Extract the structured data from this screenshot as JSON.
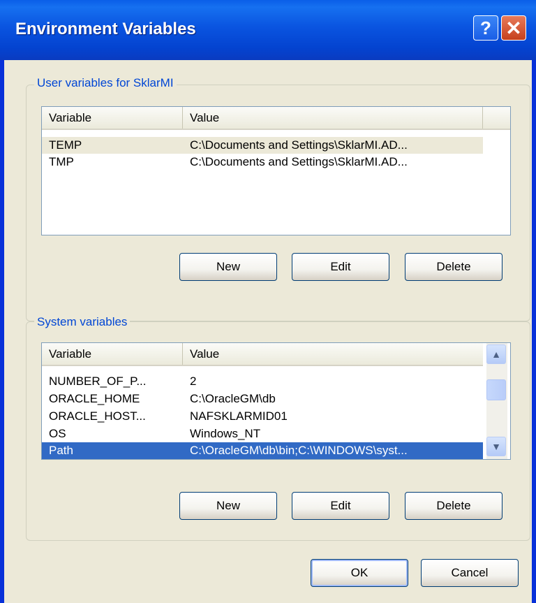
{
  "window": {
    "title": "Environment Variables",
    "help_icon": "help-icon",
    "close_icon": "close-icon"
  },
  "user_group": {
    "title": "User variables for SklarMI",
    "columns": [
      "Variable",
      "Value"
    ],
    "rows": [
      {
        "variable": "TEMP",
        "value": "C:\\Documents and Settings\\SklarMI.AD..."
      },
      {
        "variable": "TMP",
        "value": "C:\\Documents and Settings\\SklarMI.AD..."
      }
    ],
    "buttons": {
      "new": "New",
      "edit": "Edit",
      "delete": "Delete"
    }
  },
  "system_group": {
    "title": "System variables",
    "columns": [
      "Variable",
      "Value"
    ],
    "rows": [
      {
        "variable": "NUMBER_OF_P...",
        "value": "2"
      },
      {
        "variable": "ORACLE_HOME",
        "value": "C:\\OracleGM\\db"
      },
      {
        "variable": "ORACLE_HOST...",
        "value": "NAFSKLARMID01"
      },
      {
        "variable": "OS",
        "value": "Windows_NT"
      },
      {
        "variable": "Path",
        "value": "C:\\OracleGM\\db\\bin;C:\\WINDOWS\\syst..."
      }
    ],
    "selected_row": "Path",
    "buttons": {
      "new": "New",
      "edit": "Edit",
      "delete": "Delete"
    }
  },
  "footer": {
    "ok": "OK",
    "cancel": "Cancel"
  }
}
